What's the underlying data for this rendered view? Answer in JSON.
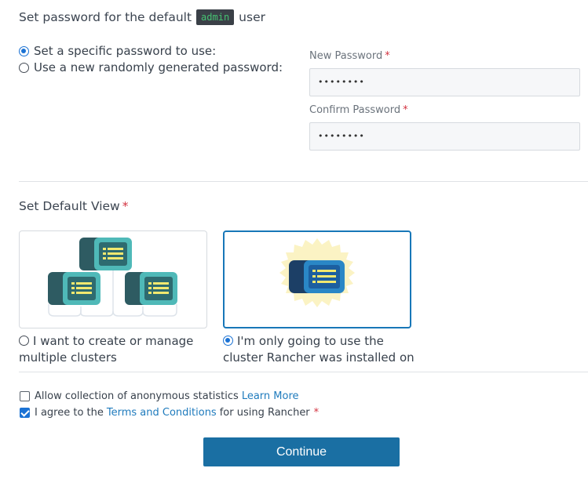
{
  "password_section": {
    "title_prefix": "Set password for the default",
    "username": "admin",
    "title_suffix": "user",
    "options": [
      {
        "label": "Set a specific password to use:",
        "selected": true
      },
      {
        "label": "Use a new randomly generated password:",
        "selected": false
      }
    ],
    "new_password": {
      "label": "New Password",
      "required_mark": "*",
      "value": "••••••••"
    },
    "confirm_password": {
      "label": "Confirm Password",
      "required_mark": "*",
      "value": "••••••••"
    }
  },
  "view_section": {
    "title": "Set Default View",
    "required_mark": "*",
    "options": [
      {
        "line1": "I want to create or manage",
        "line2": "multiple clusters",
        "selected": false,
        "icon": "multiple-clusters-icon"
      },
      {
        "line1": "I'm only going to use the",
        "line2": "cluster Rancher was installed on",
        "selected": true,
        "icon": "single-cluster-icon"
      }
    ]
  },
  "agreements": {
    "stats": {
      "text": "Allow collection of anonymous statistics",
      "link": "Learn More",
      "checked": false
    },
    "terms": {
      "prefix": "I agree to the",
      "link": "Terms and Conditions",
      "suffix": "for using Rancher",
      "required_mark": "*",
      "checked": true
    }
  },
  "continue_label": "Continue",
  "colors": {
    "accent": "#1a6fa3",
    "radio_checked": "#1b72d4",
    "required": "#d33340",
    "link": "#1f7bbd",
    "code_bg": "#3a4047",
    "code_text": "#46c172",
    "server_dark": "#2e5b62",
    "server_teal": "#4fb9b8",
    "server_list": "#f1e86f",
    "burst": "#fbf3c4",
    "blue_server": "#1c5fa0"
  }
}
